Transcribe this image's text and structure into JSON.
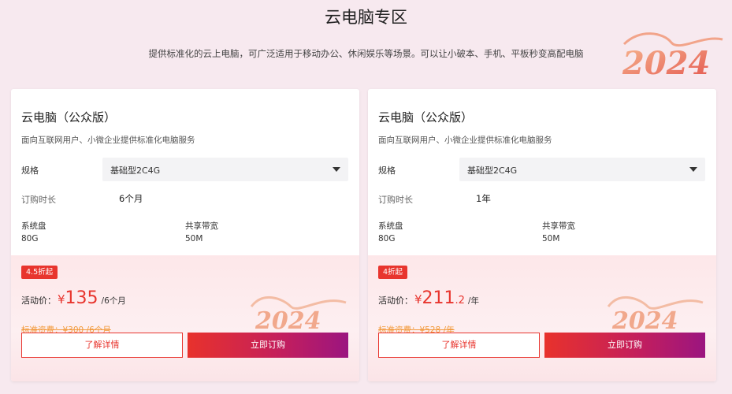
{
  "header": {
    "title": "云电脑专区",
    "subtitle": "提供标准化的云上电脑，可广泛适用于移动办公、休闲娱乐等场景。可以让小破本、手机、平板秒变高配电脑",
    "decoration_text": "2024"
  },
  "colors": {
    "accent": "#e8352e",
    "strike_price": "#f29a3c",
    "buy_gradient_end": "#9b1580",
    "page_bg": "#f7e9ef"
  },
  "cards": [
    {
      "title": "云电脑（公众版）",
      "description": "面向互联网用户、小微企业提供标准化电脑服务",
      "spec_label": "规格",
      "spec_value": "基础型2C4G",
      "duration_label": "订购时长",
      "duration_value": "6个月",
      "attrs": [
        {
          "label": "系统盘",
          "value": "80G"
        },
        {
          "label": "共享带宽",
          "value": "50M"
        }
      ],
      "discount_badge": "4.5折起",
      "price_label": "活动价：",
      "currency": "¥",
      "price_int": "135",
      "price_dec": "",
      "price_unit": "/6个月",
      "original_price": "标准资费：¥300 /6个月",
      "detail_button": "了解详情",
      "buy_button": "立即订购"
    },
    {
      "title": "云电脑（公众版）",
      "description": "面向互联网用户、小微企业提供标准化电脑服务",
      "spec_label": "规格",
      "spec_value": "基础型2C4G",
      "duration_label": "订购时长",
      "duration_value": "1年",
      "attrs": [
        {
          "label": "系统盘",
          "value": "80G"
        },
        {
          "label": "共享带宽",
          "value": "50M"
        }
      ],
      "discount_badge": "4折起",
      "price_label": "活动价：",
      "currency": "¥",
      "price_int": "211",
      "price_dec": ".2",
      "price_unit": "/年",
      "original_price": "标准资费：¥528 /年",
      "detail_button": "了解详情",
      "buy_button": "立即订购"
    }
  ]
}
